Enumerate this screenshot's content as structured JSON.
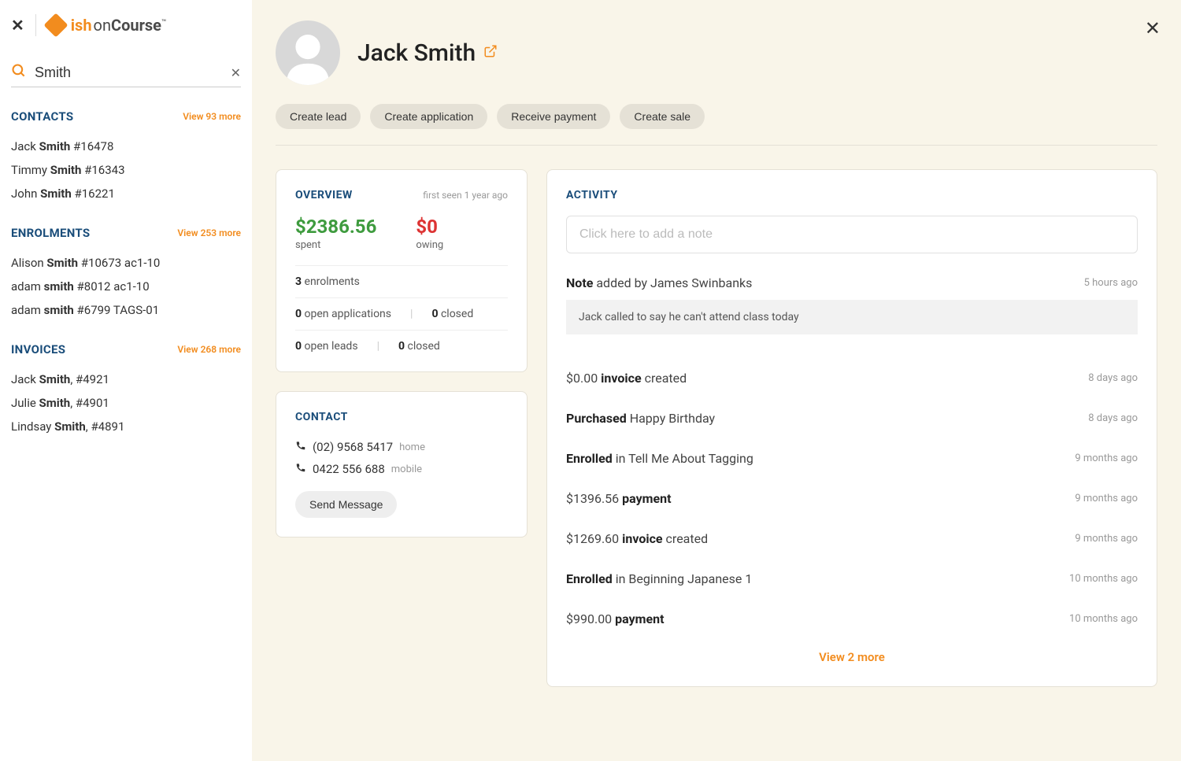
{
  "logo": {
    "brand": "ish",
    "on": "on",
    "course": "Course"
  },
  "search": {
    "value": "Smith"
  },
  "sections": {
    "contacts": {
      "title": "CONTACTS",
      "more": "View 93 more",
      "items": [
        {
          "first": "Jack ",
          "bold": "Smith",
          "rest": " #16478"
        },
        {
          "first": "Timmy ",
          "bold": "Smith",
          "rest": " #16343"
        },
        {
          "first": "John ",
          "bold": "Smith",
          "rest": " #16221"
        }
      ]
    },
    "enrolments": {
      "title": "ENROLMENTS",
      "more": "View 253 more",
      "items": [
        {
          "first": "Alison ",
          "bold": "Smith",
          "rest": " #10673 ac1-10"
        },
        {
          "first": "adam ",
          "bold": "smith",
          "rest": " #8012 ac1-10"
        },
        {
          "first": "adam ",
          "bold": "smith",
          "rest": " #6799 TAGS-01"
        }
      ]
    },
    "invoices": {
      "title": "INVOICES",
      "more": "View 268 more",
      "items": [
        {
          "first": "Jack ",
          "bold": "Smith",
          "rest": ", #4921"
        },
        {
          "first": "Julie ",
          "bold": "Smith",
          "rest": ", #4901"
        },
        {
          "first": "Lindsay ",
          "bold": "Smith",
          "rest": ", #4891"
        }
      ]
    }
  },
  "profile": {
    "name": "Jack Smith"
  },
  "chips": {
    "lead": "Create lead",
    "app": "Create application",
    "receive": "Receive payment",
    "sale": "Create sale"
  },
  "overview": {
    "title": "OVERVIEW",
    "first_seen": "first seen 1 year ago",
    "spent": "$2386.56",
    "spent_label": "spent",
    "owing": "$0",
    "owing_label": "owing",
    "enrolments_count": "3",
    "enrolments_label": " enrolments",
    "open_apps_count": "0",
    "open_apps_label": " open applications",
    "closed_apps_count": "0",
    "closed_apps_label": " closed",
    "open_leads_count": "0",
    "open_leads_label": " open leads",
    "closed_leads_count": "0",
    "closed_leads_label": " closed"
  },
  "contact": {
    "title": "CONTACT",
    "phone1": "(02) 9568 5417",
    "phone1_label": "home",
    "phone2": "0422 556 688",
    "phone2_label": "mobile",
    "send": "Send Message"
  },
  "activity": {
    "title": "ACTIVITY",
    "note_placeholder": "Click here to add a note",
    "view_more": "View 2 more",
    "items": [
      {
        "bold": "Note",
        "text": " added by James Swinbanks",
        "time": "5 hours ago",
        "body": "Jack called to say he can't attend class today"
      },
      {
        "pre": "$0.00 ",
        "bold": "invoice",
        "text": " created",
        "time": "8 days ago"
      },
      {
        "bold": "Purchased",
        "text": " Happy Birthday",
        "time": "8 days ago"
      },
      {
        "bold": "Enrolled",
        "text": " in Tell Me About Tagging",
        "time": "9 months ago"
      },
      {
        "pre": "$1396.56 ",
        "bold": "payment",
        "text": "",
        "time": "9 months ago"
      },
      {
        "pre": "$1269.60 ",
        "bold": "invoice",
        "text": " created",
        "time": "9 months ago"
      },
      {
        "bold": "Enrolled",
        "text": " in Beginning Japanese 1",
        "time": "10 months ago"
      },
      {
        "pre": "$990.00 ",
        "bold": "payment",
        "text": "",
        "time": "10 months ago"
      }
    ]
  }
}
